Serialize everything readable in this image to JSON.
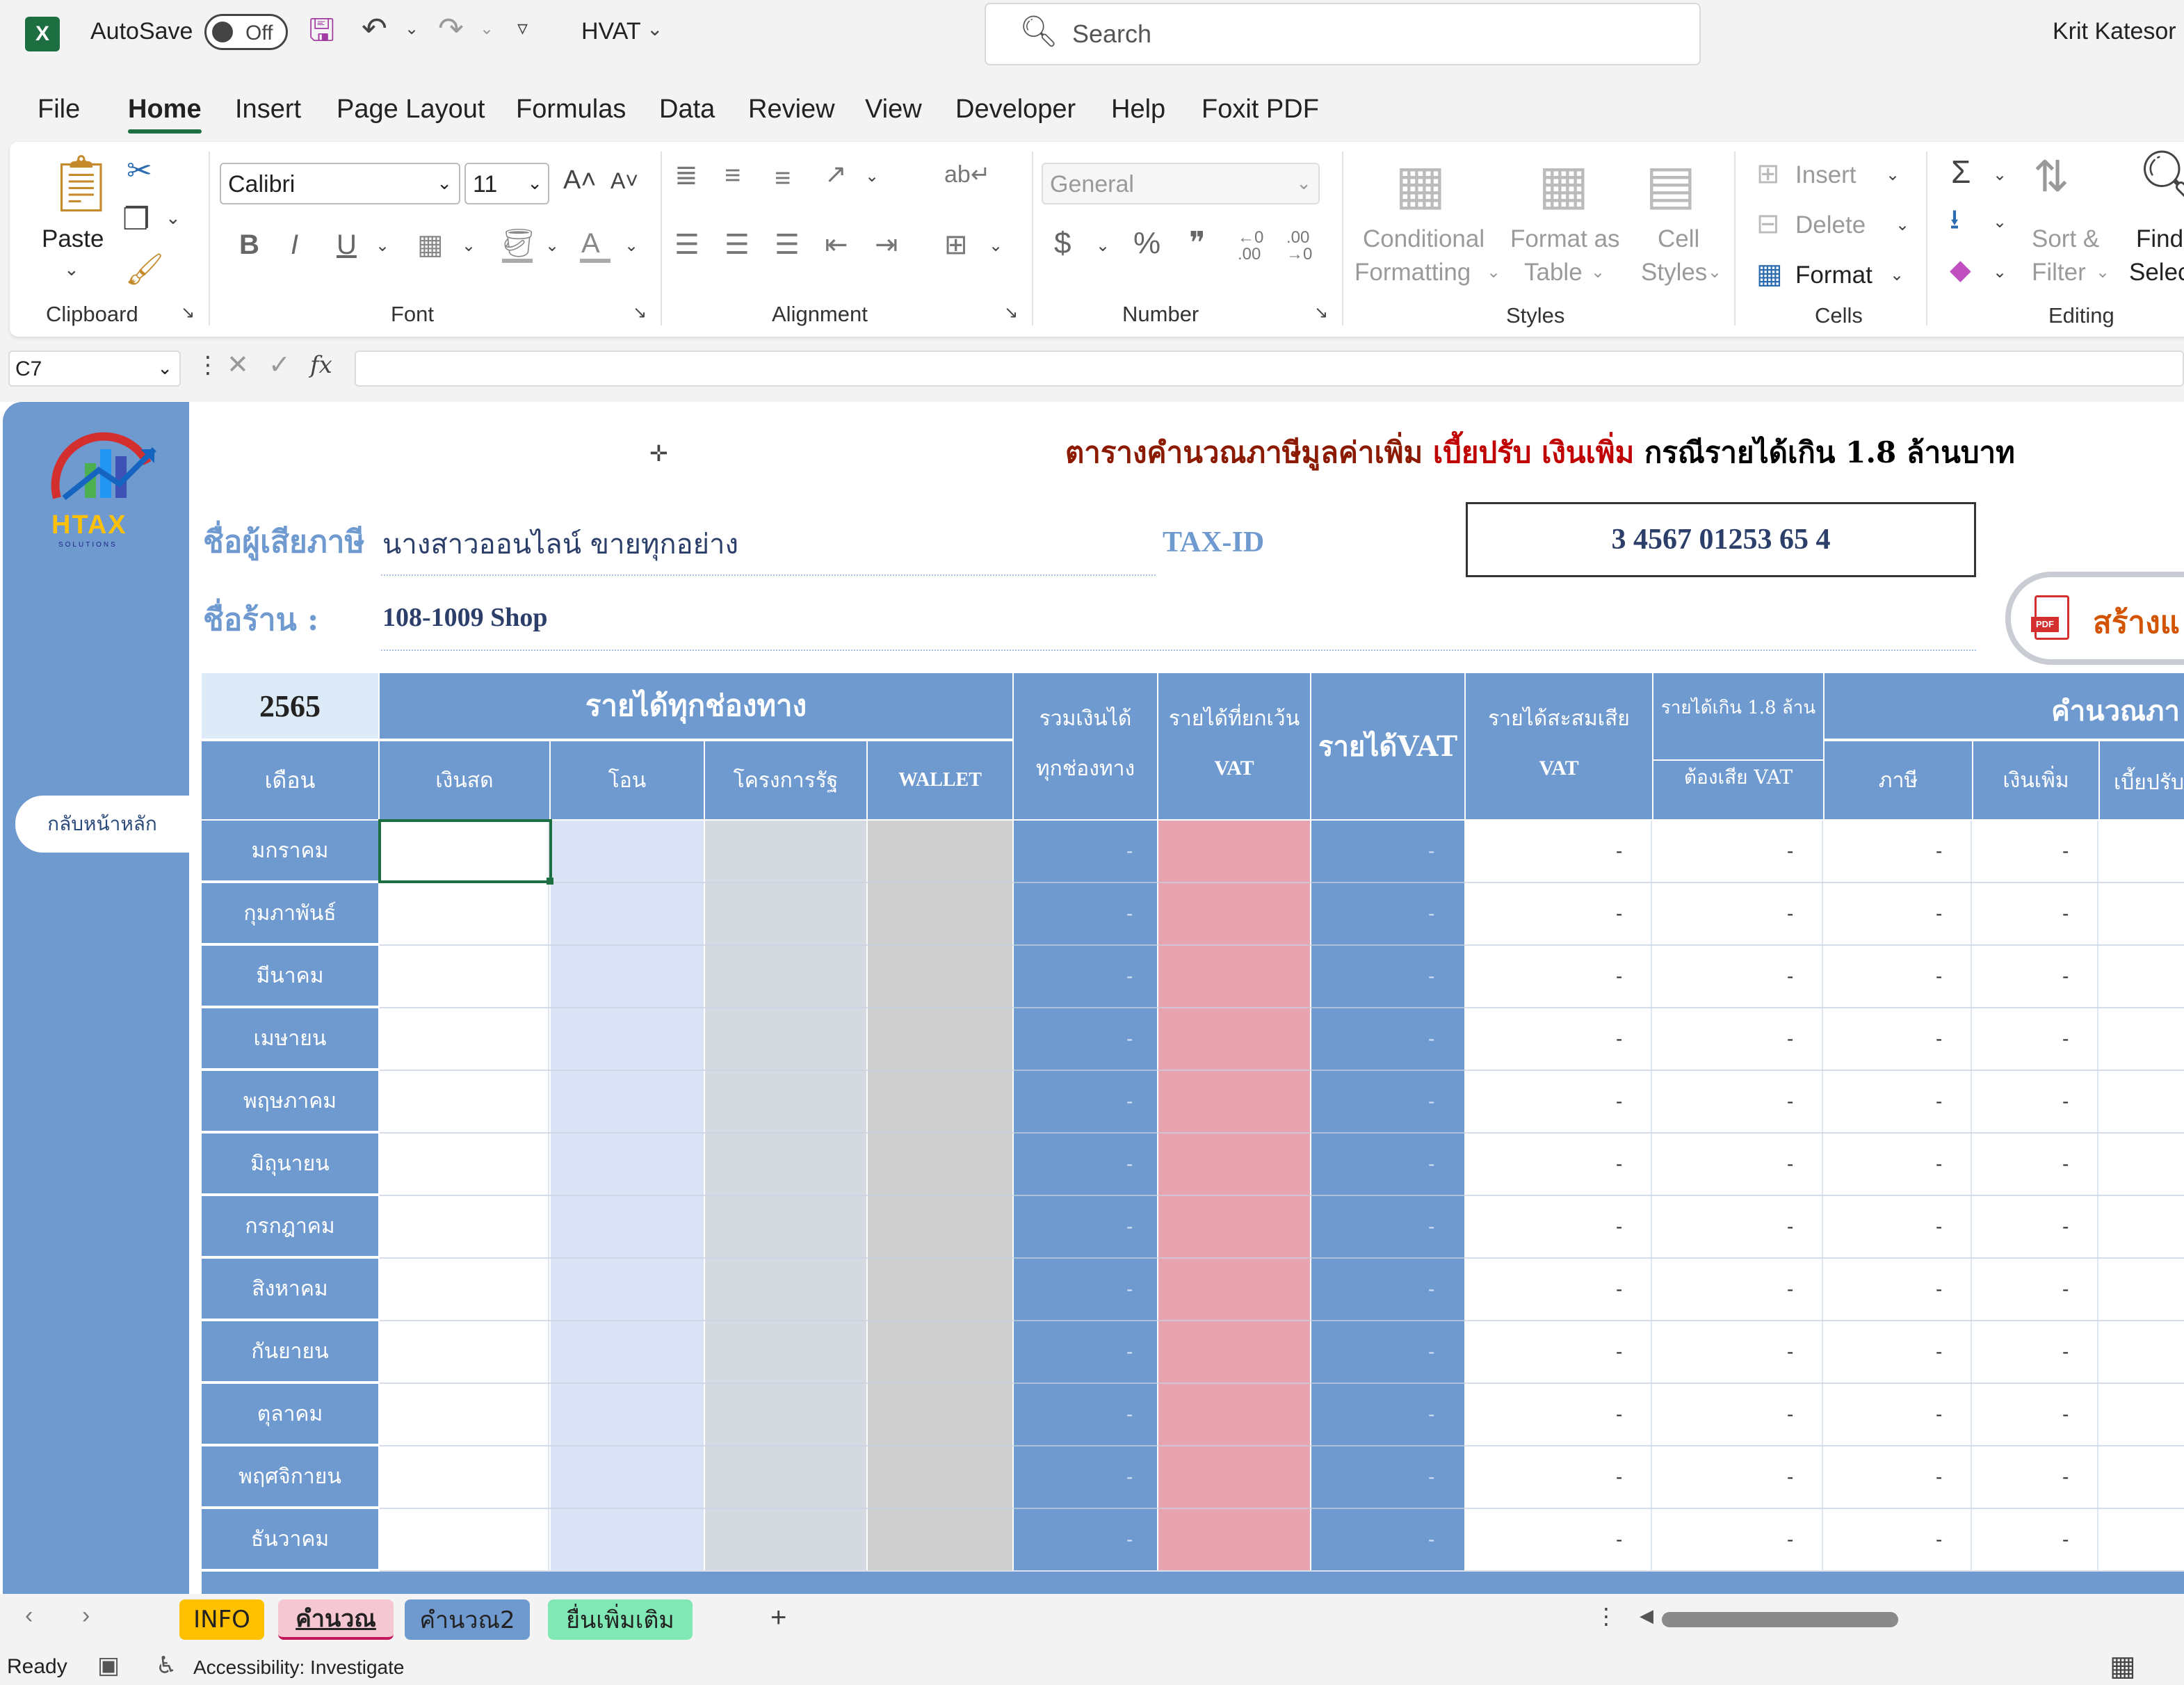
{
  "titlebar": {
    "autosave_label": "AutoSave",
    "autosave_state": "Off",
    "filename": "HVAT",
    "search_placeholder": "Search",
    "user": "Krit Katesor"
  },
  "ribbon_tabs": [
    "File",
    "Home",
    "Insert",
    "Page Layout",
    "Formulas",
    "Data",
    "Review",
    "View",
    "Developer",
    "Help",
    "Foxit PDF"
  ],
  "ribbon": {
    "clipboard": {
      "paste": "Paste",
      "group": "Clipboard"
    },
    "font": {
      "name": "Calibri",
      "size": "11",
      "group": "Font"
    },
    "alignment": {
      "group": "Alignment"
    },
    "number": {
      "format": "General",
      "group": "Number"
    },
    "styles": {
      "conditional": "Conditional",
      "formatting": "Formatting",
      "format_as": "Format as",
      "table": "Table",
      "cell": "Cell",
      "cell_styles": "Styles",
      "group": "Styles"
    },
    "cells": {
      "insert": "Insert",
      "delete": "Delete",
      "format": "Format",
      "group": "Cells"
    },
    "editing": {
      "sort": "Sort &",
      "filter": "Filter",
      "find": "Find &",
      "select": "Select",
      "group": "Editing"
    }
  },
  "formula_bar": {
    "name_box": "C7",
    "fx": "fx",
    "formula": ""
  },
  "sheet": {
    "title_a": "ตารางคำนวณภาษีมูลค่าเพิ่ม",
    "title_b": "เบี้ยปรับ เงินเพิ่ม",
    "title_c": "กรณีรายได้เกิน 1.8 ล้านบาท",
    "taxpayer_label": "ชื่อผู้เสียภาษี",
    "taxpayer_name": "นางสาวออนไลน์ ขายทุกอย่าง",
    "taxid_label": "TAX-ID",
    "taxid_value": "3 4567 01253 65 4",
    "shop_label": "ชื่อร้าน :",
    "shop_name": "108-1009 Shop",
    "create_button": "สร้างแ",
    "back_button": "กลับหน้าหลัก",
    "logo_text": "HTAX",
    "logo_sub": "SOLUTIONS",
    "year": "2565",
    "header": {
      "income_channels": "รายได้ทุกช่องทาง",
      "month": "เดือน",
      "cash": "เงินสด",
      "transfer": "โอน",
      "gov": "โครงการรัฐ",
      "wallet": "WALLET",
      "total_1": "รวมเงินได้",
      "total_2": "ทุกช่องทาง",
      "exempt_1": "รายได้ที่ยกเว้น",
      "exempt_2": "VAT",
      "vat_income": "รายได้VAT",
      "accum_1": "รายได้สะสมเสีย",
      "accum_2": "VAT",
      "over_1": "รายได้เกิน 1.8 ล้าน",
      "over_2": "ต้องเสีย VAT",
      "calc": "คำนวณภา",
      "tax": "ภาษี",
      "surcharge": "เงินเพิ่ม",
      "penalty": "เบี้ยปรับ"
    },
    "months": [
      "มกราคม",
      "กุมภาพันธ์",
      "มีนาคม",
      "เมษายน",
      "พฤษภาคม",
      "มิถุนายน",
      "กรกฎาคม",
      "สิงหาคม",
      "กันยายน",
      "ตุลาคม",
      "พฤศจิกายน",
      "ธันวาคม"
    ],
    "dash": "-"
  },
  "sheet_tabs": [
    "INFO",
    "คำนวณ",
    "คำนวณ2",
    "ยื่นเพิ่มเติม"
  ],
  "sheet_tab_add": "+",
  "status": {
    "ready": "Ready",
    "accessibility": "Accessibility: Investigate"
  },
  "colors": {
    "header_blue": "#6f9ad0",
    "pink": "#e8a3b0",
    "light_blue": "#d9e3f5",
    "gray1": "#d5d9e0",
    "gray2": "#cfcfcf",
    "title_red": "#c00000",
    "title_brown": "#8b1a00",
    "excel_green": "#1d6f42"
  }
}
